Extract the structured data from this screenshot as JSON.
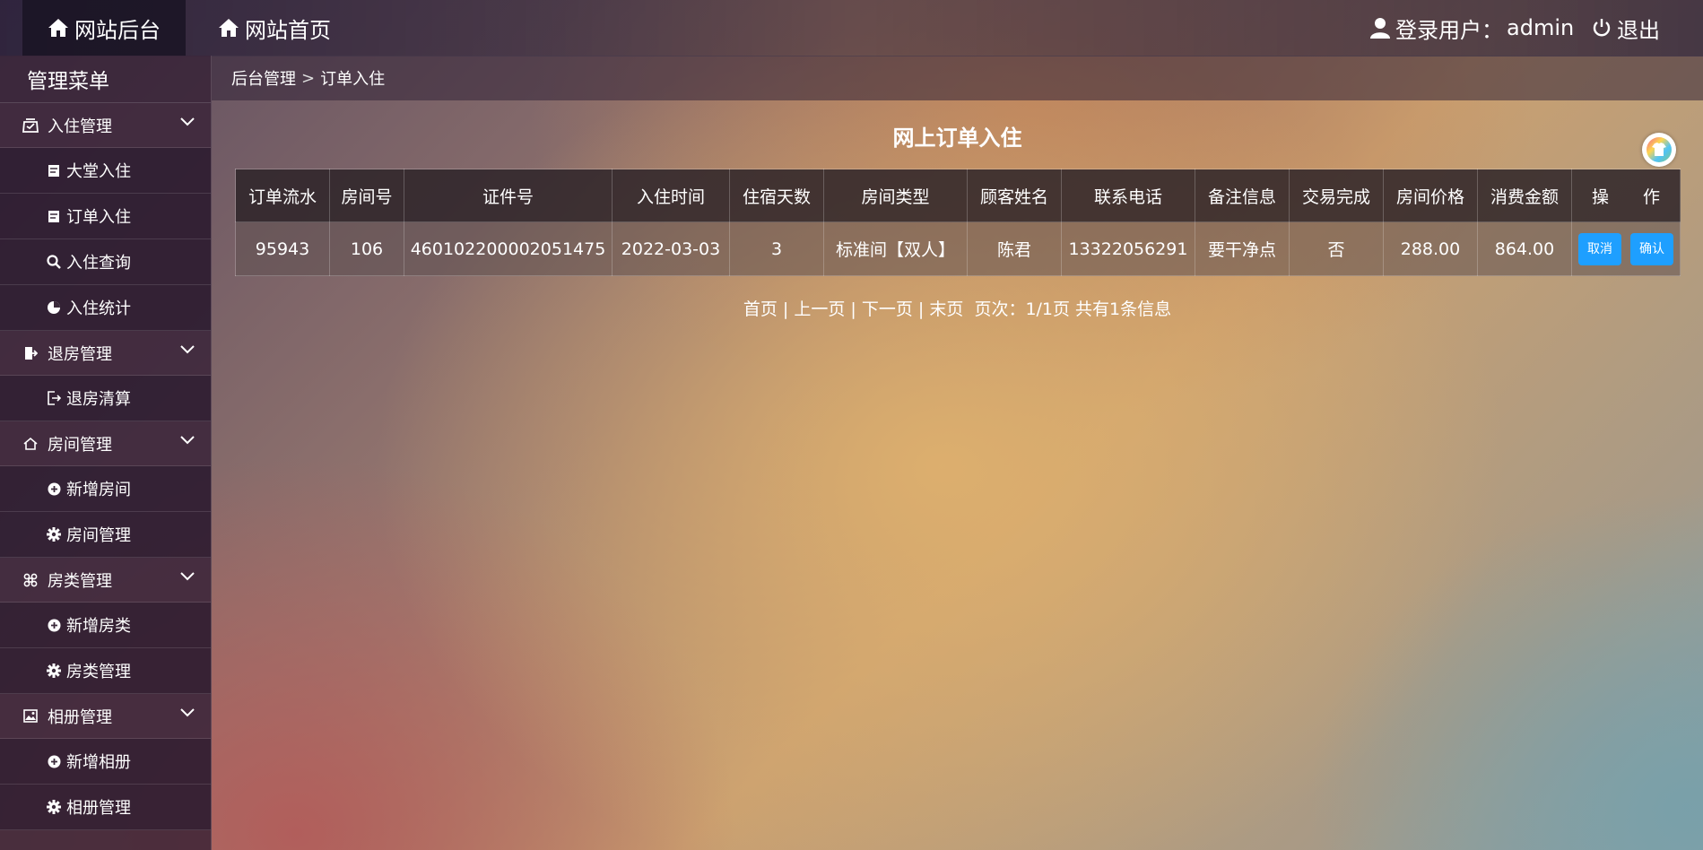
{
  "topbar": {
    "brand": "网站后台",
    "home": "网站首页",
    "user_label": "登录用户：",
    "username": "admin",
    "logout": "退出"
  },
  "sidebar": {
    "title": "管理菜单",
    "groups": [
      {
        "label": "入住管理",
        "icon": "inbox-icon",
        "items": [
          {
            "label": "大堂入住",
            "icon": "document-icon"
          },
          {
            "label": "订单入住",
            "icon": "document-icon"
          },
          {
            "label": "入住查询",
            "icon": "search-icon"
          },
          {
            "label": "入住统计",
            "icon": "pie-chart-icon"
          }
        ]
      },
      {
        "label": "退房管理",
        "icon": "door-icon",
        "items": [
          {
            "label": "退房清算",
            "icon": "sign-out-icon"
          }
        ]
      },
      {
        "label": "房间管理",
        "icon": "house-icon",
        "items": [
          {
            "label": "新增房间",
            "icon": "plus-circle-icon"
          },
          {
            "label": "房间管理",
            "icon": "gear-icon"
          }
        ]
      },
      {
        "label": "房类管理",
        "icon": "command-icon",
        "items": [
          {
            "label": "新增房类",
            "icon": "plus-circle-icon"
          },
          {
            "label": "房类管理",
            "icon": "gear-icon"
          }
        ]
      },
      {
        "label": "相册管理",
        "icon": "picture-icon",
        "items": [
          {
            "label": "新增相册",
            "icon": "plus-circle-icon"
          },
          {
            "label": "相册管理",
            "icon": "gear-icon"
          }
        ]
      }
    ]
  },
  "breadcrumb": {
    "root": "后台管理",
    "separator": ">",
    "current": "订单入住"
  },
  "main": {
    "title": "网上订单入住",
    "table": {
      "headers": [
        "订单流水",
        "房间号",
        "证件号",
        "入住时间",
        "住宿天数",
        "房间类型",
        "顾客姓名",
        "联系电话",
        "备注信息",
        "交易完成",
        "房间价格",
        "消费金额",
        "操　　作"
      ],
      "rows": [
        [
          "95943",
          "106",
          "460102200002051475",
          "2022-03-03",
          "3",
          "标准间【双人】",
          "陈君",
          "13322056291",
          "要干净点",
          "否",
          "288.00",
          "864.00"
        ]
      ],
      "actions": {
        "cancel": "取消",
        "confirm": "确认"
      }
    },
    "pager": {
      "first": "首页",
      "prev": "上一页",
      "next": "下一页",
      "last": "末页",
      "divider": "|",
      "info": "页次：1/1页 共有1条信息"
    }
  },
  "colors": {
    "accent": "#1e9fff"
  }
}
